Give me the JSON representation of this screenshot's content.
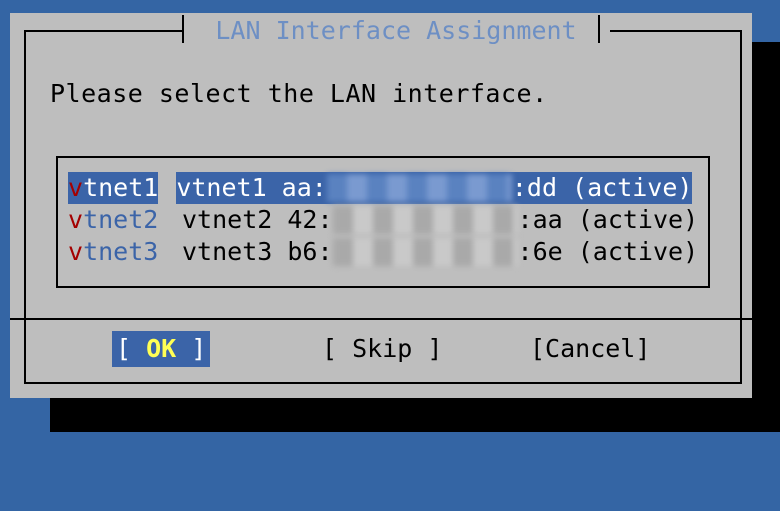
{
  "dialog": {
    "title": "LAN Interface Assignment",
    "prompt": "Please select the LAN interface.",
    "items": [
      {
        "tag_first": "v",
        "tag_rest": "tnet1",
        "desc_prefix": "vtnet1 aa:",
        "desc_suffix": ":dd (active)",
        "selected": true
      },
      {
        "tag_first": "v",
        "tag_rest": "tnet2",
        "desc_prefix": "vtnet2 42:",
        "desc_suffix": ":aa (active)",
        "selected": false
      },
      {
        "tag_first": "v",
        "tag_rest": "tnet3",
        "desc_prefix": "vtnet3 b6:",
        "desc_suffix": ":6e (active)",
        "selected": false
      }
    ],
    "buttons": {
      "ok_open": "[ ",
      "ok_label": "OK",
      "ok_close": " ]",
      "skip": "[ Skip ]",
      "cancel": "[Cancel]"
    }
  },
  "colors": {
    "background": "#3465a4",
    "dialog": "#bebebe",
    "highlight": "#3b64a8",
    "title": "#6d8fc4",
    "hotkey": "#a40000",
    "ok_label": "#ffff55"
  }
}
